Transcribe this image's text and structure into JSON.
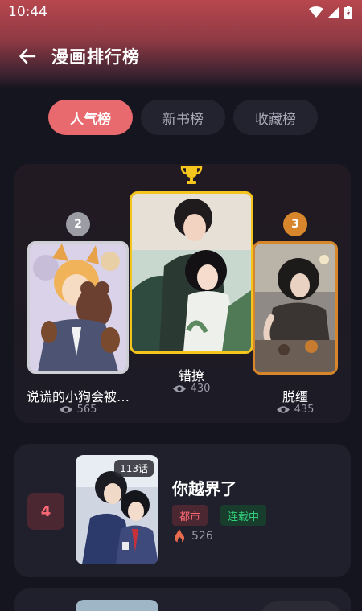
{
  "status_bar": {
    "time": "10:44"
  },
  "header": {
    "title": "漫画排行榜"
  },
  "tabs": [
    {
      "label": "人气榜",
      "active": true
    },
    {
      "label": "新书榜",
      "active": false
    },
    {
      "label": "收藏榜",
      "active": false
    }
  ],
  "podium": {
    "first": {
      "title": "错撩",
      "views": "430",
      "icon": "trophy-icon"
    },
    "second": {
      "rank": "2",
      "title": "说谎的小狗会被…",
      "views": "565"
    },
    "third": {
      "rank": "3",
      "title": "脱缰",
      "views": "435"
    }
  },
  "list": [
    {
      "rank": "4",
      "title": "你越界了",
      "episodes": "113话",
      "genre": "都市",
      "status": "连载中",
      "heat": "526"
    }
  ],
  "colors": {
    "accent": "#e86a6f",
    "silver": "#9c9ca4",
    "bronze": "#d7862b",
    "gold": "#f4c51c"
  }
}
